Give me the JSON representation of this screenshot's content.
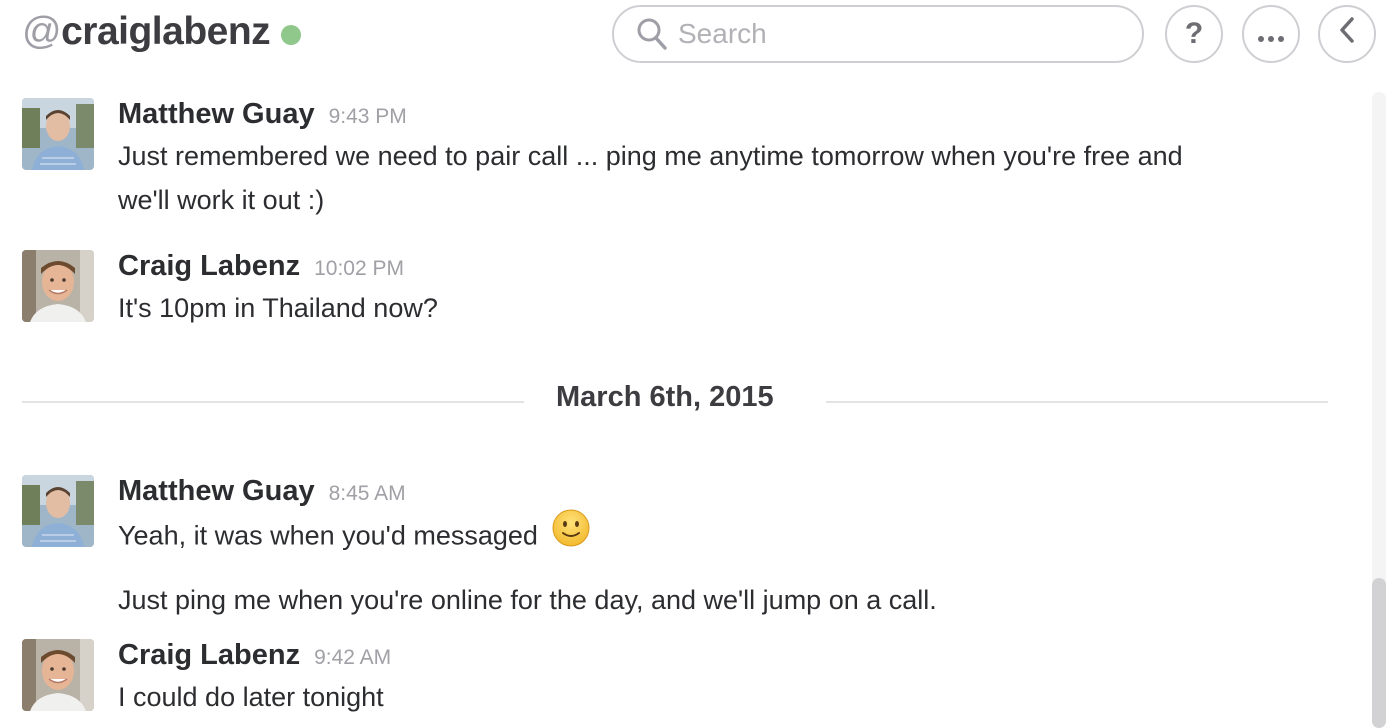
{
  "header": {
    "at_symbol": "@",
    "channel_name": "craiglabenz",
    "presence_color": "#8fc88a",
    "search_placeholder": "Search",
    "help_label": "?",
    "more_label": "···"
  },
  "icons": {
    "search": "search-icon",
    "help": "help-icon",
    "more": "ellipsis-icon",
    "back": "chevron-left-icon",
    "emoji": "slightly-smiling-emoji"
  },
  "messages": [
    {
      "author": "Matthew Guay",
      "time": "9:43 PM",
      "lines": [
        "Just remembered we need to pair call ... ping me anytime tomorrow when you're free and",
        "we'll work it out :)"
      ]
    },
    {
      "author": "Craig Labenz",
      "time": "10:02 PM",
      "lines": [
        "It's 10pm in Thailand now?"
      ]
    },
    {
      "author": "Matthew Guay",
      "time": "8:45 AM",
      "lines": [
        "Yeah, it was when you'd messaged",
        "Just ping me when you're online for the day, and we'll jump on a call."
      ]
    },
    {
      "author": "Craig Labenz",
      "time": "9:42 AM",
      "lines": [
        "I could do later tonight"
      ]
    }
  ],
  "date_divider": "March 6th, 2015"
}
